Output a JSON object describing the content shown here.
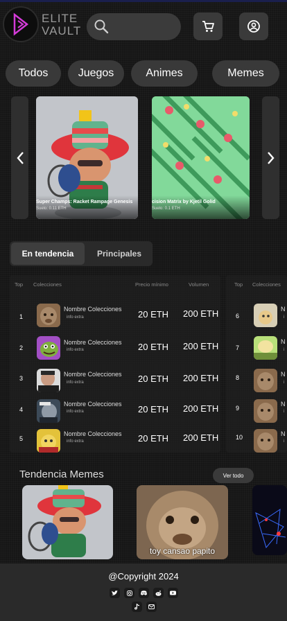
{
  "brand": {
    "line1": "ELITE",
    "line2": "VAULT"
  },
  "header": {
    "search_icon": "search-icon",
    "cart_icon": "cart-icon",
    "account_icon": "user-icon"
  },
  "categories": [
    "Todos",
    "Juegos",
    "Animes",
    "Memes"
  ],
  "carousel": {
    "cards": [
      {
        "title": "Super Champs: Racket Rampage Genesis",
        "price": "Suelo: 0.11 ETH"
      },
      {
        "title": "cision Matrix by Kjetil Golid",
        "price": "Suelo: 0.1 ETH"
      }
    ]
  },
  "tabs": {
    "active": "En tendencia",
    "other": "Principales"
  },
  "table": {
    "headers": {
      "top": "Top",
      "collections": "Colecciones",
      "min_price": "Precio mínimo",
      "volume": "Volumen"
    },
    "left_rows": [
      {
        "rank": "1",
        "name": "Nombre Colecciones",
        "info": "info extra",
        "price": "20 ETH",
        "volume": "200 ETH"
      },
      {
        "rank": "2",
        "name": "Nombre Colecciones",
        "info": "info extra",
        "price": "20 ETH",
        "volume": "200 ETH"
      },
      {
        "rank": "3",
        "name": "Nombre Colecciones",
        "info": "info extra",
        "price": "20 ETH",
        "volume": "200 ETH"
      },
      {
        "rank": "4",
        "name": "Nombre Colecciones",
        "info": "info extra",
        "price": "20 ETH",
        "volume": "200 ETH"
      },
      {
        "rank": "5",
        "name": "Nombre Colecciones",
        "info": "info extra",
        "price": "20 ETH",
        "volume": "200 ETH"
      }
    ],
    "right_rows": [
      {
        "rank": "6",
        "name": "N",
        "info": "i"
      },
      {
        "rank": "7",
        "name": "N",
        "info": "i"
      },
      {
        "rank": "8",
        "name": "N",
        "info": "i"
      },
      {
        "rank": "9",
        "name": "N",
        "info": "i"
      },
      {
        "rank": "10",
        "name": "N",
        "info": "i"
      }
    ]
  },
  "memes": {
    "title": "Tendencia Memes",
    "see_all": "Ver todo",
    "caption": "toy cansao papito"
  },
  "footer": {
    "copyright": "@Copyright 2024",
    "socials": [
      "twitter-icon",
      "instagram-icon",
      "discord-icon",
      "reddit-icon",
      "youtube-icon",
      "tiktok-icon",
      "mail-icon"
    ]
  }
}
